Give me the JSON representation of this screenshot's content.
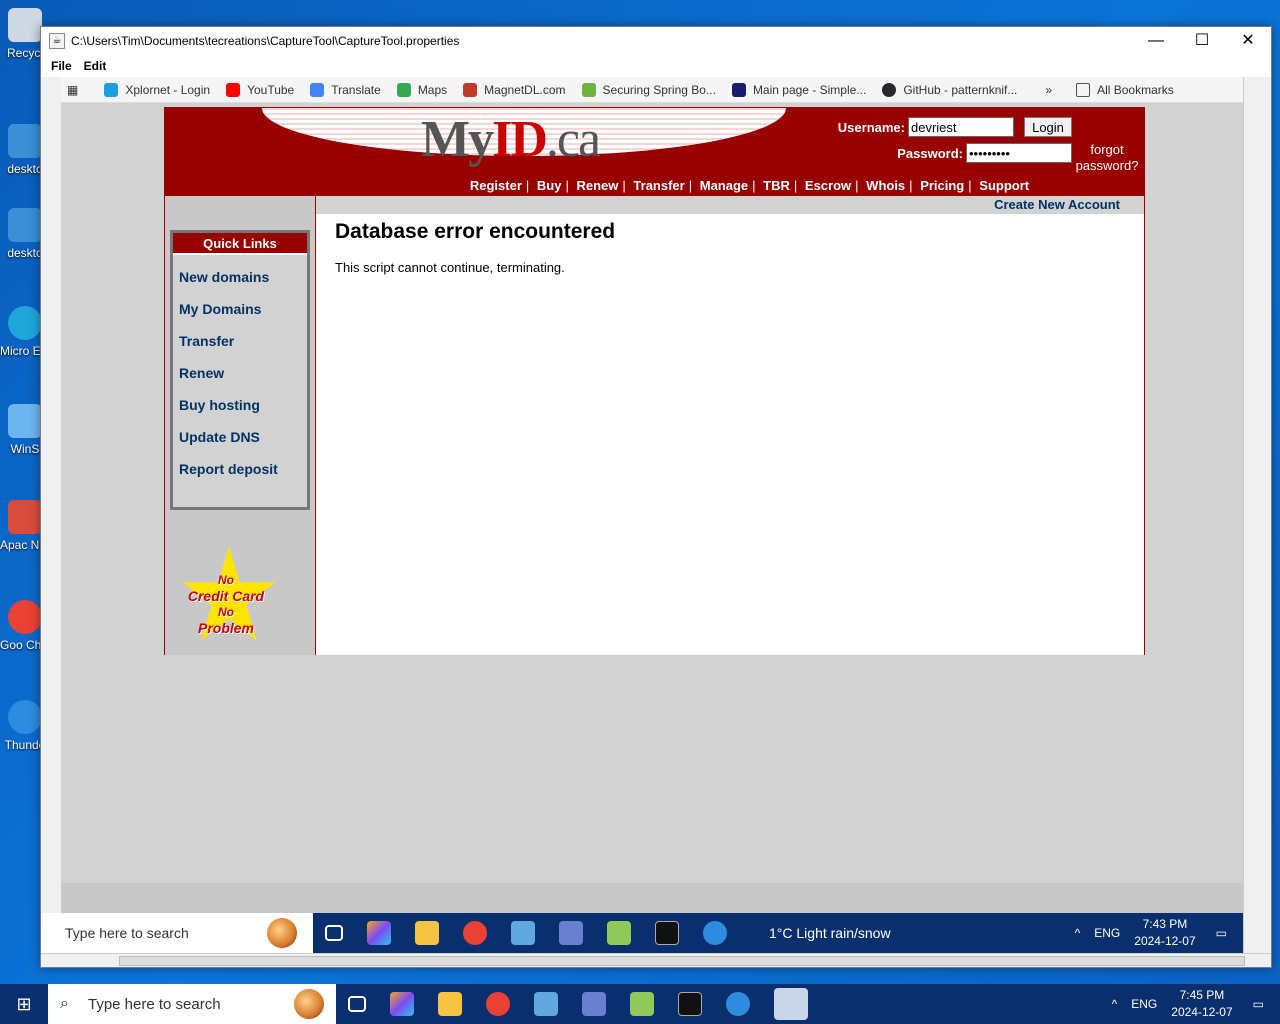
{
  "desktop": {
    "icons": [
      {
        "label": "Recycl",
        "color": "#cfd8e3"
      },
      {
        "label": "deskto",
        "color": "#3a8fd6"
      },
      {
        "label": "deskto",
        "color": "#3a8fd6"
      },
      {
        "label": "Micro Edg",
        "color": "#1ea6d8"
      },
      {
        "label": "WinS",
        "color": "#6bb6f0"
      },
      {
        "label": "Apac NetBea",
        "color": "#d94c3d"
      },
      {
        "label": "Goo Chro",
        "color": "#e94235"
      },
      {
        "label": "Thunde",
        "color": "#2d8ce0"
      }
    ]
  },
  "window": {
    "title": "C:\\Users\\Tim\\Documents\\tecreations\\CaptureTool\\CaptureTool.properties",
    "minimize": "—",
    "maximize": "☐",
    "close": "✕",
    "menu": [
      "File",
      "Edit"
    ]
  },
  "bookmarks": {
    "items": [
      {
        "label": "Xplornet - Login",
        "color": "#1aa0dc"
      },
      {
        "label": "YouTube",
        "color": "#ff0000"
      },
      {
        "label": "Translate",
        "color": "#4285f4"
      },
      {
        "label": "Maps",
        "color": "#34a853"
      },
      {
        "label": "MagnetDL.com",
        "color": "#c0392b"
      },
      {
        "label": "Securing Spring Bo...",
        "color": "#6db33f"
      },
      {
        "label": "Main page - Simple...",
        "color": "#1a1a6e"
      },
      {
        "label": "GitHub - patternknif...",
        "color": "#24292e"
      }
    ],
    "overflow": "»",
    "all": "All Bookmarks"
  },
  "site": {
    "logo": {
      "my": "My",
      "id": "ID",
      "ca": ".ca"
    },
    "login": {
      "username_label": "Username:",
      "username_value": "devriest",
      "password_label": "Password:",
      "password_value": "•••••••••",
      "login_button": "Login",
      "forgot": "forgot password?"
    },
    "nav": [
      "Register",
      "Buy",
      "Renew",
      "Transfer",
      "Manage",
      "TBR",
      "Escrow",
      "Whois",
      "Pricing",
      "Support"
    ],
    "create_account": "Create New Account",
    "quick_links": {
      "title": "Quick Links",
      "items": [
        "New domains",
        "My Domains",
        "Transfer",
        "Renew",
        "Buy hosting",
        "Update DNS",
        "Report deposit"
      ]
    },
    "promo": {
      "line1": "No",
      "line2": "Credit Card",
      "line3": "No",
      "line4": "Problem"
    },
    "error_title": "Database error encountered",
    "error_message": "This script cannot continue, terminating."
  },
  "inner_taskbar": {
    "search_placeholder": "Type here to search",
    "weather": "1°C  Light rain/snow",
    "lang": "ENG",
    "time": "7:43 PM",
    "date": "2024-12-07"
  },
  "taskbar": {
    "search_placeholder": "Type here to search",
    "lang": "ENG",
    "time": "7:45 PM",
    "date": "2024-12-07"
  }
}
